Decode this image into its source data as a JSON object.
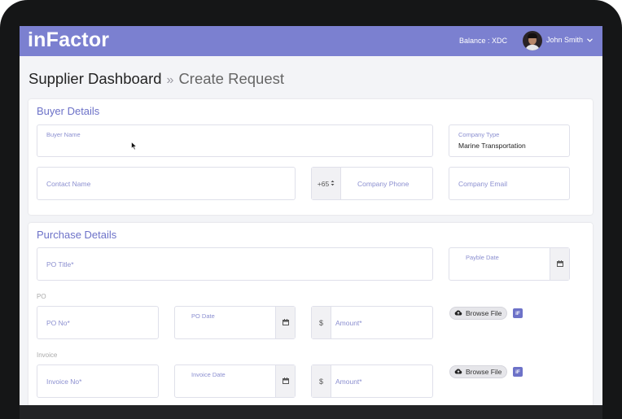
{
  "header": {
    "logo": "inFactor",
    "balance": "Balance : XDC",
    "user_name": "John Smith",
    "chevron": "⌄"
  },
  "breadcrumb": {
    "root": "Supplier Dashboard",
    "separator": "»",
    "current": "Create Request"
  },
  "buyer": {
    "title": "Buyer Details",
    "buyer_name": "Buyer Name",
    "company_type_label": "Company Type",
    "company_type_value": "Marine Transportation",
    "contact_name": "Contact Name",
    "phone_code": "+65",
    "company_phone": "Company Phone",
    "company_email": "Company Email"
  },
  "purchase": {
    "title": "Purchase Details",
    "po_title": "PO Title*",
    "payble_date": "Payble Date",
    "po_section": "PO",
    "po_no": "PO No*",
    "po_date": "PO Date",
    "currency": "$",
    "amount": "Amount*",
    "browse": "Browse File",
    "badge": "iF",
    "invoice_section": "Invoice",
    "invoice_no": "Invoice No*",
    "invoice_date": "Invoice Date"
  },
  "colors": {
    "topbar": "#7b80d0",
    "accent": "#6d72c8",
    "placeholder": "#8b8fd0"
  }
}
